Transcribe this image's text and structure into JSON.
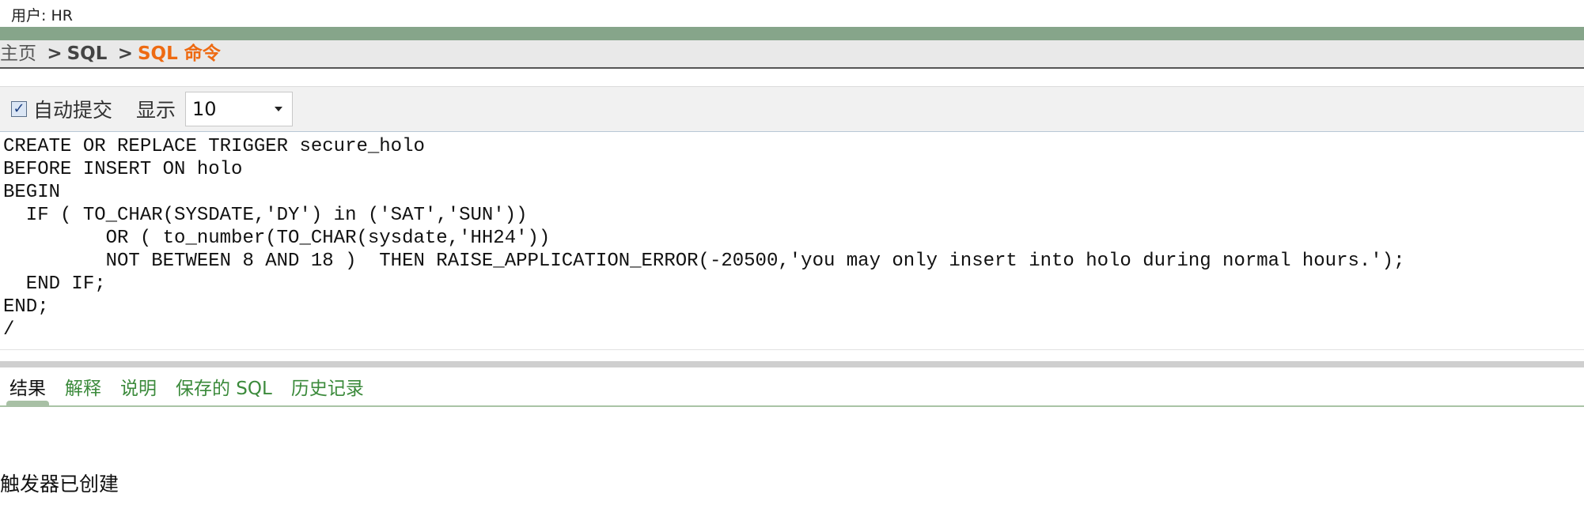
{
  "header": {
    "user_label": "用户: HR"
  },
  "breadcrumb": {
    "home": "主页",
    "sep1": ">",
    "sql": "SQL",
    "sep2": ">",
    "current": "SQL 命令"
  },
  "toolbar": {
    "autocommit_checked": true,
    "autocommit_label": "自动提交",
    "show_label": "显示",
    "show_value": "10"
  },
  "code": {
    "lines": [
      "CREATE OR REPLACE TRIGGER secure_holo",
      "BEFORE INSERT ON holo",
      "BEGIN",
      "  IF ( TO_CHAR(SYSDATE,'DY') in ('SAT','SUN'))",
      "         OR ( to_number(TO_CHAR(sysdate,'HH24'))",
      "         NOT BETWEEN 8 AND 18 )  THEN RAISE_APPLICATION_ERROR(-20500,'you may only insert into holo during normal hours.');",
      "  END IF;",
      "END;",
      "/"
    ]
  },
  "tabs": [
    {
      "label": "结果",
      "active": true
    },
    {
      "label": "解释",
      "active": false
    },
    {
      "label": "说明",
      "active": false
    },
    {
      "label": "保存的 SQL",
      "active": false
    },
    {
      "label": "历史记录",
      "active": false
    }
  ],
  "result": {
    "message": "触发器已创建"
  },
  "colors": {
    "accent_orange": "#ee6a12",
    "tab_green": "#3b8a3b",
    "band_green": "#86a58a"
  }
}
